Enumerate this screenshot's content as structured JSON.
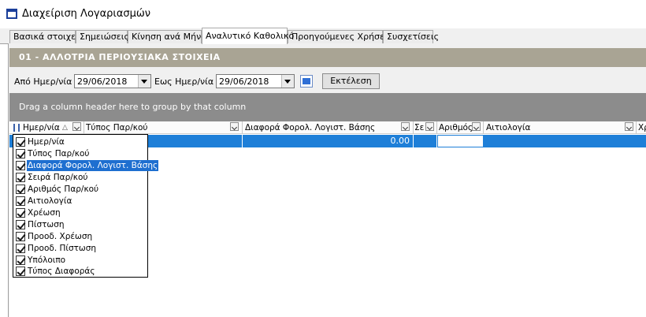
{
  "window": {
    "title": "Διαχείριση Λογαριασμών"
  },
  "tabs": [
    {
      "label": "Βασικά στοιχεία"
    },
    {
      "label": "Σημειώσεις"
    },
    {
      "label": "Κίνηση ανά Μήνα"
    },
    {
      "label": "Αναλυτικό Καθολικό",
      "active": true
    },
    {
      "label": "Προηγούμενες Χρήσεις"
    },
    {
      "label": "Συσχετίσεις"
    }
  ],
  "account_header": "01 - ΑΛΛΟΤΡΙΑ ΠΕΡΙΟΥΣΙΑΚΑ ΣΤΟΙΧΕΙΑ",
  "filters": {
    "from_label": "Από Ημερ/νία :",
    "from_value": "29/06/2018",
    "to_label": "Εως Ημερ/νία :",
    "to_value": "29/06/2018",
    "execute_label": "Εκτέλεση"
  },
  "group_hint": "Drag a column header here to group by that column",
  "columns": [
    {
      "label": "Ημερ/νία"
    },
    {
      "label": "Τύπος Παρ/κού"
    },
    {
      "label": "Διαφορά Φορολ. Λογιστ. Βάσης"
    },
    {
      "label": "Σε"
    },
    {
      "label": "Αριθμός"
    },
    {
      "label": "Αιτιολογία"
    },
    {
      "label": "Χρ"
    }
  ],
  "row": {
    "diff_value": "0.00"
  },
  "column_chooser": [
    {
      "label": "Ημερ/νία",
      "checked": true
    },
    {
      "label": "Τύπος Παρ/κού",
      "checked": true
    },
    {
      "label": "Διαφορά Φορολ. Λογιστ. Βάσης",
      "checked": true,
      "highlighted": true
    },
    {
      "label": "Σειρά Παρ/κού",
      "checked": true
    },
    {
      "label": "Αριθμός Παρ/κού",
      "checked": true
    },
    {
      "label": "Αιτιολογία",
      "checked": true
    },
    {
      "label": "Χρέωση",
      "checked": true
    },
    {
      "label": "Πίστωση",
      "checked": true
    },
    {
      "label": "Προοδ. Χρέωση",
      "checked": true
    },
    {
      "label": "Προοδ. Πίστωση",
      "checked": true
    },
    {
      "label": "Υπόλοιπο",
      "checked": true
    },
    {
      "label": "Τύπος Διαφοράς",
      "checked": true
    }
  ],
  "colors": {
    "selection": "#1e7fd8",
    "header_band": "#a9a494",
    "group_area": "#8c8c8c"
  }
}
